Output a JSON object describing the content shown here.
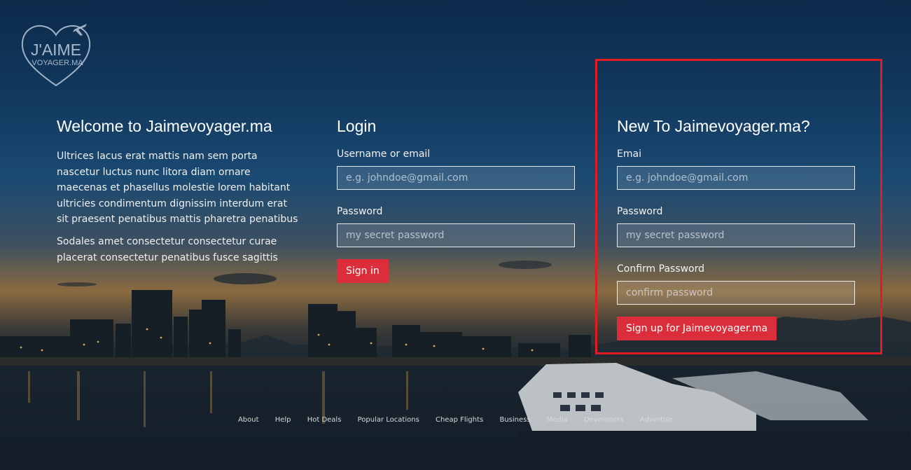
{
  "brand": {
    "logo_line1": "J'AIME",
    "logo_line2": "VOYAGER.MA"
  },
  "welcome": {
    "title": "Welcome to Jaimevoyager.ma",
    "paragraph1": "Ultrices lacus erat mattis nam sem porta nascetur luctus nunc litora diam ornare maecenas et phasellus molestie lorem habitant ultricies condimentum dignissim interdum erat sit praesent penatibus mattis pharetra penatibus",
    "paragraph2": "Sodales amet consectetur consectetur curae placerat consectetur penatibus fusce sagittis"
  },
  "login": {
    "title": "Login",
    "username_label": "Username or email",
    "username_placeholder": "e.g. johndoe@gmail.com",
    "password_label": "Password",
    "password_placeholder": "my secret password",
    "submit_label": "Sign in"
  },
  "signup": {
    "title": "New To Jaimevoyager.ma?",
    "email_label": "Emai",
    "email_placeholder": "e.g. johndoe@gmail.com",
    "password_label": "Password",
    "password_placeholder": "my secret password",
    "confirm_label": "Confirm Password",
    "confirm_placeholder": "confirm password",
    "submit_label": "Sign up for Jaimevoyager.ma"
  },
  "footer": {
    "links": [
      "About",
      "Help",
      "Hot Deals",
      "Popular Locations",
      "Cheap Flights",
      "Business",
      "Media",
      "Developers",
      "Advertise"
    ]
  },
  "colors": {
    "accent": "#db2d3a",
    "highlight": "#e01b22"
  }
}
